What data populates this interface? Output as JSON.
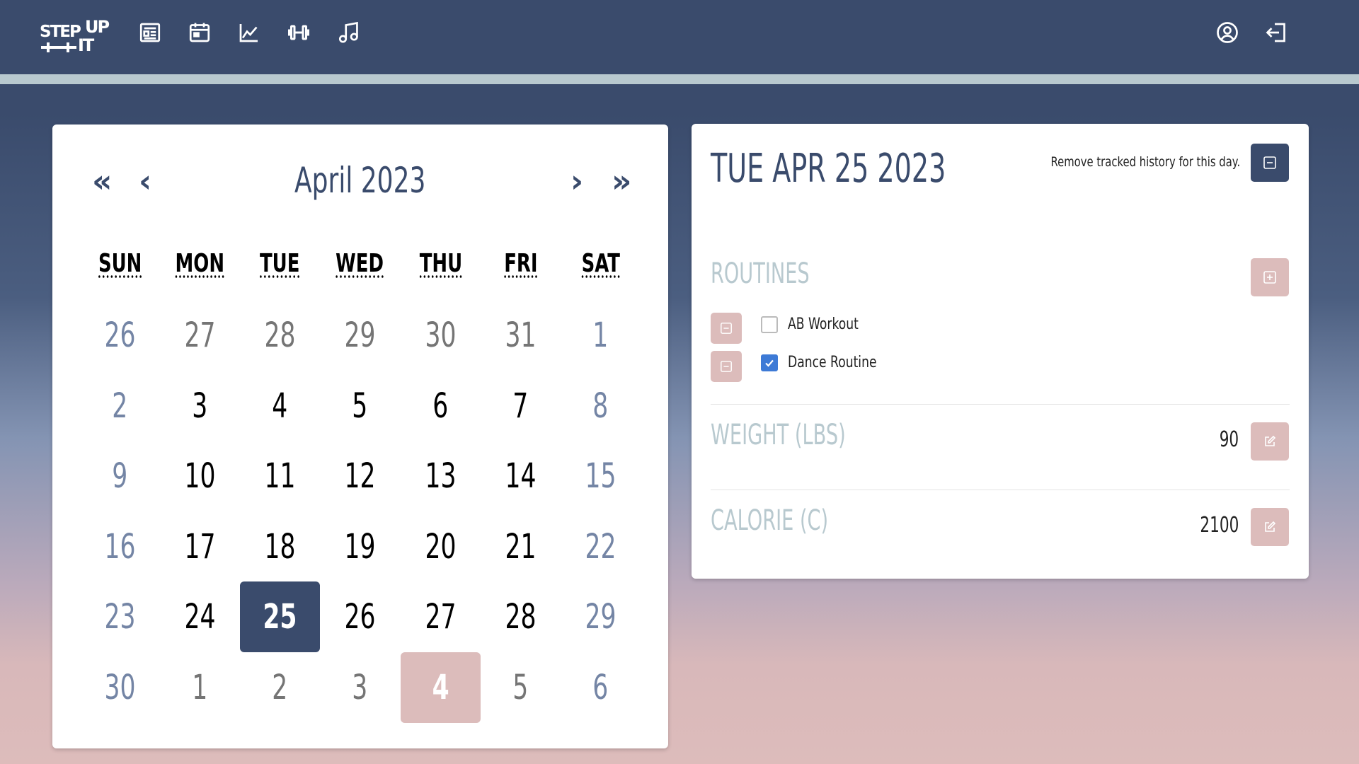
{
  "nav": {
    "logo": {
      "line1": "STEP",
      "line2": "UP",
      "line3": "IT"
    },
    "icons": [
      "newspaper-icon",
      "calendar-icon",
      "chart-line-icon",
      "dumbbell-icon",
      "music-icon",
      "user-circle-icon",
      "logout-icon"
    ]
  },
  "calendar": {
    "title": "April 2023",
    "prev_year": "«",
    "prev_month": "‹",
    "next_month": "›",
    "next_year": "»",
    "weekdays": [
      "SUN",
      "MON",
      "TUE",
      "WED",
      "THU",
      "FRI",
      "SAT"
    ],
    "weeks": [
      [
        "26",
        "27",
        "28",
        "29",
        "30",
        "31",
        "1"
      ],
      [
        "2",
        "3",
        "4",
        "5",
        "6",
        "7",
        "8"
      ],
      [
        "9",
        "10",
        "11",
        "12",
        "13",
        "14",
        "15"
      ],
      [
        "16",
        "17",
        "18",
        "19",
        "20",
        "21",
        "22"
      ],
      [
        "23",
        "24",
        "25",
        "26",
        "27",
        "28",
        "29"
      ],
      [
        "30",
        "1",
        "2",
        "3",
        "4",
        "5",
        "6"
      ]
    ],
    "selected": "25",
    "today": "4"
  },
  "detail": {
    "date": "TUE APR 25 2023",
    "remove_label": "Remove tracked history for this day.",
    "routines_title": "ROUTINES",
    "routines": [
      {
        "label": "AB Workout",
        "checked": false
      },
      {
        "label": "Dance Routine",
        "checked": true
      }
    ],
    "weight_title": "WEIGHT (LBS)",
    "weight_value": "90",
    "calorie_title": "CALORIE (C)",
    "calorie_value": "2100"
  },
  "colors": {
    "navy": "#3a4b6c",
    "pink": "#dcbcbb",
    "light_blue": "#b8c9cf",
    "check_blue": "#3d7ad6"
  }
}
